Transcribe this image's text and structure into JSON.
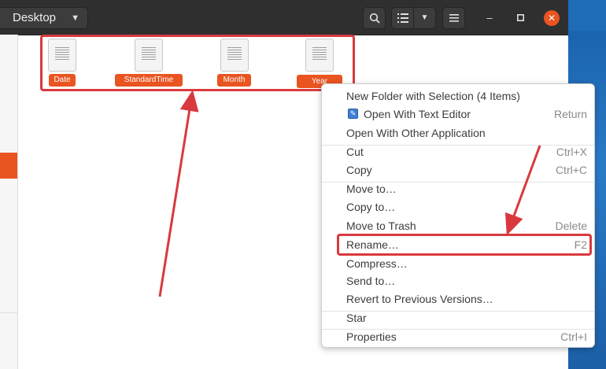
{
  "header": {
    "location": "Desktop"
  },
  "icons": {
    "search": "search-icon",
    "list_view": "list-view-icon",
    "menu": "hamburger-menu-icon"
  },
  "files": [
    {
      "name": "Date"
    },
    {
      "name": "StandardTime"
    },
    {
      "name": "Month"
    },
    {
      "name": "Year"
    }
  ],
  "context_menu": {
    "items": [
      {
        "label": "New Folder with Selection (4 Items)",
        "shortcut": ""
      },
      {
        "label": "Open With Text Editor",
        "shortcut": "Return"
      },
      {
        "label": "Open With Other Application",
        "shortcut": ""
      },
      {
        "label": "Cut",
        "shortcut": "Ctrl+X"
      },
      {
        "label": "Copy",
        "shortcut": "Ctrl+C"
      },
      {
        "label": "Move to…",
        "shortcut": ""
      },
      {
        "label": "Copy to…",
        "shortcut": ""
      },
      {
        "label": "Move to Trash",
        "shortcut": "Delete"
      },
      {
        "label": "Rename…",
        "shortcut": "F2"
      },
      {
        "label": "Compress…",
        "shortcut": ""
      },
      {
        "label": "Send to…",
        "shortcut": ""
      },
      {
        "label": "Revert to Previous Versions…",
        "shortcut": ""
      },
      {
        "label": "Star",
        "shortcut": ""
      },
      {
        "label": "Properties",
        "shortcut": "Ctrl+I"
      }
    ]
  },
  "colors": {
    "accent": "#e95420",
    "annotation": "#d9393e",
    "header_bg": "#2f2f2f"
  }
}
